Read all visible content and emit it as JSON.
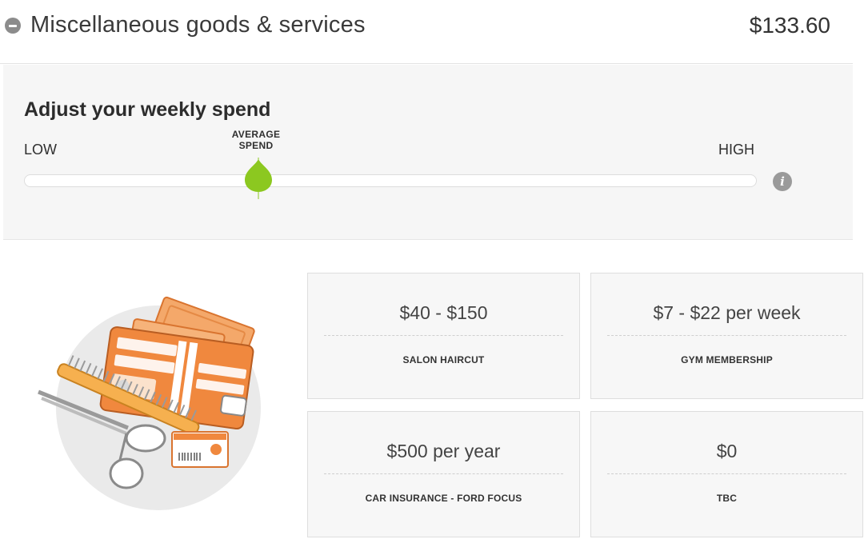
{
  "section": {
    "title": "Miscellaneous goods & services",
    "total": "$133.60",
    "collapse_icon": "minus-circle-icon"
  },
  "adjust": {
    "title": "Adjust your weekly spend",
    "low_label": "LOW",
    "high_label": "HIGH",
    "average_label_line1": "AVERAGE",
    "average_label_line2": "SPEND",
    "slider_value_fraction": 0.32,
    "thumb_color": "#8cc820",
    "info_icon": "info-icon"
  },
  "illustration": {
    "icon": "wallet-scissors-comb-illustration",
    "accent_color": "#f0883e"
  },
  "cards": [
    {
      "value": "$40 - $150",
      "label": "SALON HAIRCUT"
    },
    {
      "value": "$7 - $22 per week",
      "label": "GYM MEMBERSHIP"
    },
    {
      "value": "$500 per year",
      "label": "CAR INSURANCE - FORD FOCUS"
    },
    {
      "value": "$0",
      "label": "TBC"
    }
  ]
}
